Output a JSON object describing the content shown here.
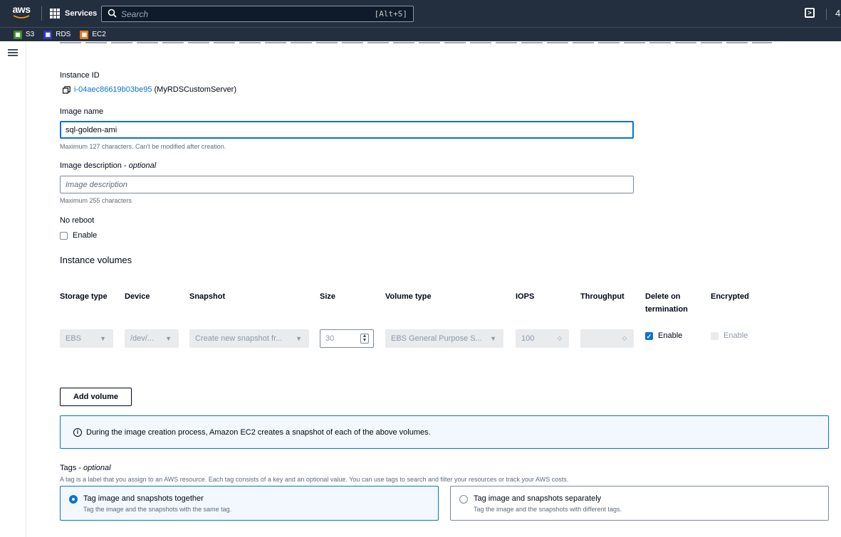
{
  "topnav": {
    "logo": "aws",
    "services_label": "Services",
    "search_placeholder": "Search",
    "search_shortcut": "[Alt+S]",
    "cut_char": "4"
  },
  "favorites": [
    {
      "label": "S3",
      "color": "#3f8624",
      "icon": "s3-icon"
    },
    {
      "label": "RDS",
      "color": "#3334b9",
      "icon": "rds-icon"
    },
    {
      "label": "EC2",
      "color": "#e07a1c",
      "icon": "ec2-icon"
    }
  ],
  "form": {
    "instance_id_label": "Instance ID",
    "instance_id": "i-04aec86619b03be95",
    "instance_name": "(MyRDSCustomServer)",
    "image_name_label": "Image name",
    "image_name_value": "sql-golden-ami",
    "image_name_hint": "Maximum 127 characters. Can't be modified after creation.",
    "image_desc_label": "Image description",
    "optional": "optional",
    "image_desc_placeholder": "Image description",
    "image_desc_hint": "Maximum 255 characters",
    "no_reboot_label": "No reboot",
    "enable_label": "Enable"
  },
  "volumes": {
    "title": "Instance volumes",
    "headers": {
      "storage_type": "Storage type",
      "device": "Device",
      "snapshot": "Snapshot",
      "size": "Size",
      "volume_type": "Volume type",
      "iops": "IOPS",
      "throughput": "Throughput",
      "delete_on_termination": "Delete on termination",
      "encrypted": "Encrypted"
    },
    "row": {
      "storage_type": "EBS",
      "device": "/dev/...",
      "snapshot": "Create new snapshot fr...",
      "size": "30",
      "volume_type": "EBS General Purpose S...",
      "iops": "100",
      "throughput": "",
      "delete_on_termination": "Enable",
      "encrypted": "Enable"
    },
    "add_volume_label": "Add volume",
    "info_text": "During the image creation process, Amazon EC2 creates a snapshot of each of the above volumes."
  },
  "tags": {
    "label": "Tags",
    "optional": "optional",
    "description": "A tag is a label that you assign to an AWS resource. Each tag consists of a key and an optional value. You can use tags to search and filter your resources or track your AWS costs.",
    "options": [
      {
        "title": "Tag image and snapshots together",
        "subtitle": "Tag the image and the snapshots with the same tag.",
        "selected": true
      },
      {
        "title": "Tag image and snapshots separately",
        "subtitle": "Tag the image and the snapshots with different tags.",
        "selected": false
      }
    ]
  },
  "colors": {
    "nav_bg": "#232f3e",
    "link": "#0972d3",
    "info_bg": "#f2f8fd"
  }
}
